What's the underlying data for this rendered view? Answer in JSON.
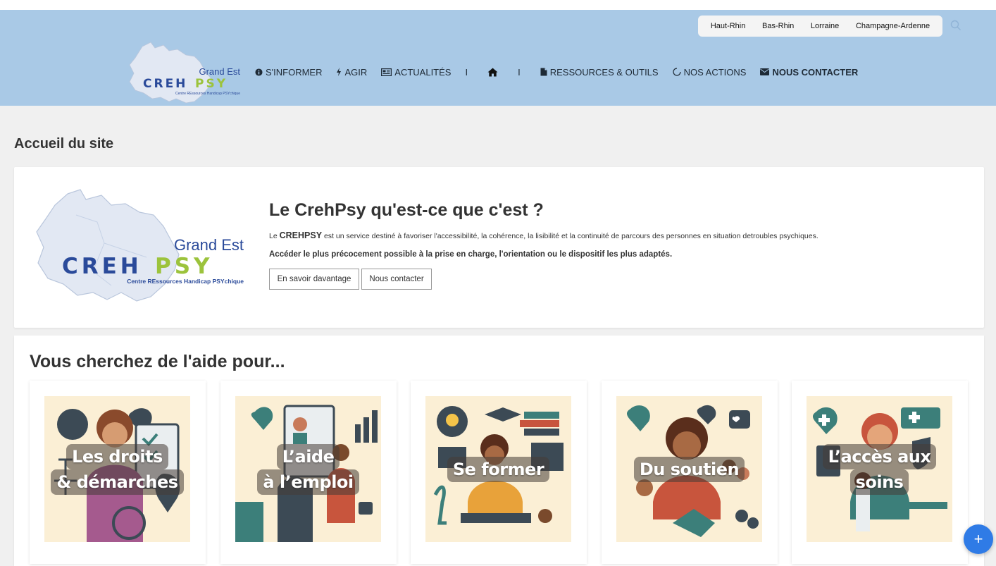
{
  "header": {
    "regions": [
      "Haut-Rhin",
      "Bas-Rhin",
      "Lorraine",
      "Champagne-Ardenne"
    ],
    "logo": {
      "region": "Grand Est",
      "name_part1": "CREH",
      "name_part2": "PSY",
      "tagline": "Centre REssources Handicap PSYchique"
    },
    "nav": {
      "informer": "S'INFORMER",
      "agir": "AGIR",
      "actualites": "ACTUALITÉS",
      "separator": "I",
      "ressources": "RESSOURCES & OUTILS",
      "actions": "NOS ACTIONS",
      "contact": "NOUS CONTACTER"
    }
  },
  "page": {
    "title": "Accueil du site"
  },
  "hero": {
    "heading": "Le CrehPsy qu'est-ce que c'est ?",
    "para1_prefix": "Le ",
    "para1_strong": "CREHPSY",
    "para1_rest": " est un service destiné à favoriser l'accessibilité, la cohérence, la lisibilité et la continuité de parcours des personnes en situation detroubles psychiques.",
    "para2": "Accéder le plus précocement possible à la prise en charge, l'orientation ou le dispositif les plus adaptés.",
    "btn_more": "En savoir davantage",
    "btn_contact": "Nous contacter"
  },
  "aide": {
    "heading": "Vous cherchez de l'aide pour...",
    "cards": [
      {
        "line1": "Les droits",
        "line2": "& démarches"
      },
      {
        "line1": "L’aide",
        "line2": "à l’emploi"
      },
      {
        "line1": "Se former",
        "line2": ""
      },
      {
        "line1": "Du soutien",
        "line2": ""
      },
      {
        "line1": "L’accès aux",
        "line2": "soins"
      }
    ]
  },
  "fab": {
    "label": "+"
  },
  "colors": {
    "header_bg": "#a9c9e6",
    "logo_blue": "#2a4a9a",
    "logo_green": "#9cc33c",
    "fab": "#2f7be6",
    "card_bg": "#fbefd5"
  }
}
